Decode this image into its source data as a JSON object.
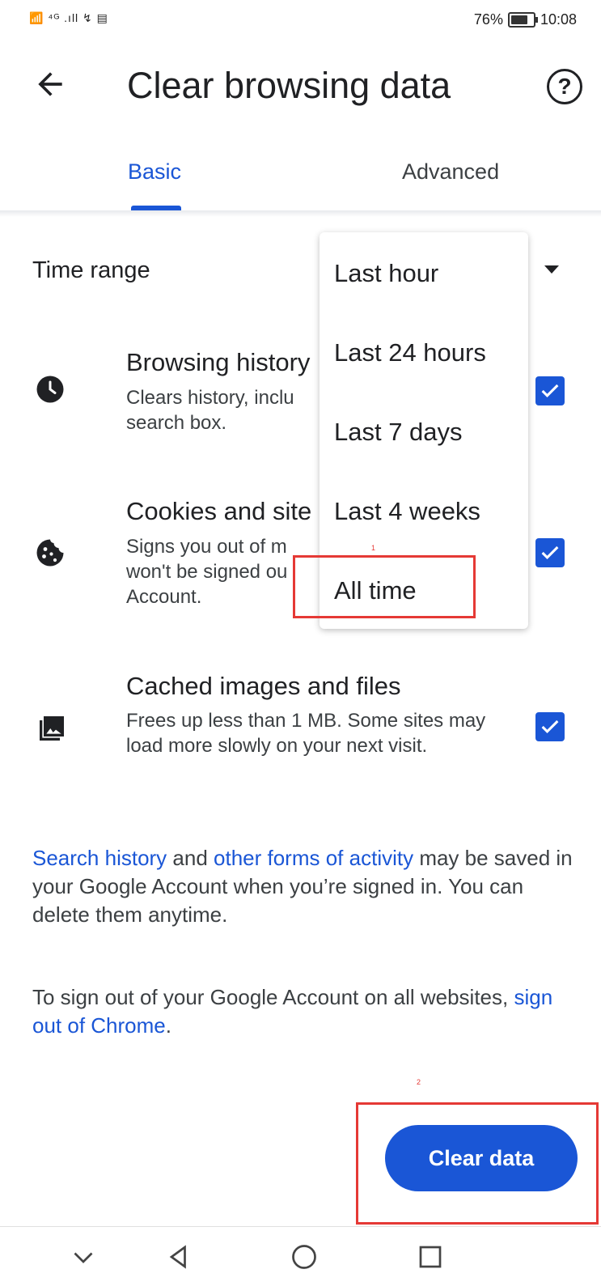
{
  "status_bar": {
    "left_indicators": "📶 ⁴ᴳ .ıll ↯ ▤",
    "battery": "76%",
    "time": "10:08"
  },
  "header": {
    "title": "Clear browsing data",
    "back_icon": "arrow-left-icon",
    "help_icon": "help-circle-icon"
  },
  "tabs": [
    {
      "label": "Basic",
      "active": true
    },
    {
      "label": "Advanced",
      "active": false
    }
  ],
  "time_range": {
    "label": "Time range",
    "options": [
      "Last hour",
      "Last 24 hours",
      "Last 7 days",
      "Last 4 weeks",
      "All time"
    ]
  },
  "items": [
    {
      "title": "Browsing history",
      "desc_line1": "Clears history, inclu",
      "desc_line2": "search box.",
      "icon": "clock-icon",
      "checked": true
    },
    {
      "title": "Cookies and site",
      "desc_line1": "Signs you out of m",
      "desc_line2": "won't be signed ou",
      "desc_line3": "Account.",
      "icon": "cookie-icon",
      "checked": true
    },
    {
      "title": "Cached images and files",
      "desc": "Frees up less than 1 MB. Some sites may load more slowly on your next visit.",
      "icon": "image-icon",
      "checked": true
    }
  ],
  "info": {
    "link1": "Search history",
    "text1": " and ",
    "link2": "other forms of activity",
    "text2": " may be saved in your Google Account when you’re signed in. You can delete them anytime.",
    "signout_text": "To sign out of your Google Account on all websites, ",
    "signout_link": "sign out of Chrome",
    "signout_end": "."
  },
  "annotations": [
    "1",
    "2"
  ],
  "clear_button": "Clear data",
  "colors": {
    "accent": "#1a56d6",
    "annotation": "#e53935"
  }
}
